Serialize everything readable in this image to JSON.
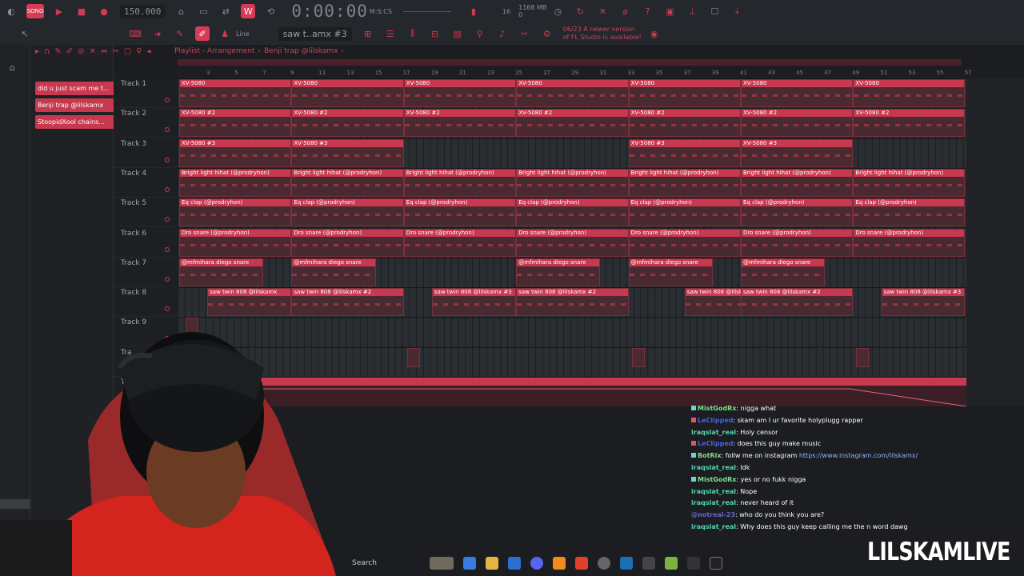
{
  "toolbar": {
    "song_mode": "SONG",
    "tempo": "150.000",
    "time": "0:00:00",
    "time_unit": "M:S:CS",
    "memory": "1168 MB",
    "memory_value": "0",
    "snap": "Line",
    "pattern": "saw t..amx #3",
    "notice_date": "06/23",
    "notice_text": "A newer version of FL Studio is available!",
    "cpu": "16"
  },
  "playlist": {
    "title": "Playlist - Arrangement",
    "pattern": "Benji trap @lilskamx",
    "ruler": [
      "3",
      "5",
      "7",
      "9",
      "11",
      "13",
      "15",
      "17",
      "19",
      "21",
      "23",
      "25",
      "27",
      "29",
      "31",
      "33",
      "35",
      "37",
      "39",
      "41",
      "43",
      "45",
      "47",
      "49",
      "51",
      "53",
      "55",
      "57"
    ]
  },
  "patterns": [
    {
      "label": "did u just scam me t..."
    },
    {
      "label": "Benji trap @lilskamx"
    },
    {
      "label": "StoopidXool chains..."
    }
  ],
  "tracks": [
    {
      "name": "Track 1"
    },
    {
      "name": "Track 2"
    },
    {
      "name": "Track 3"
    },
    {
      "name": "Track 4"
    },
    {
      "name": "Track 5"
    },
    {
      "name": "Track 6"
    },
    {
      "name": "Track 7"
    },
    {
      "name": "Track 8"
    },
    {
      "name": "Track 9"
    },
    {
      "name": "Tra"
    },
    {
      "name": "Tr"
    }
  ],
  "clip_names": {
    "xv1": "XV-5080",
    "xv2": "XV-5080 #2",
    "xv3": "XV-5080 #3",
    "hihat": "Bright light hihat (@prodryhon)",
    "clap": "Eq clap (@prodryhon)",
    "snare": "Dro snare (@prodryhon)",
    "diego": "@mfmihara diego snare",
    "saw1": "saw twin 808 @lilskamx",
    "saw2": "saw twin 808 @lilskamx #2",
    "saw3": "saw twin 808 @lilskamx #3"
  },
  "chat": [
    {
      "user": "MistGodRx",
      "color": "green",
      "msg": ": nigga what"
    },
    {
      "user": "LeClipped",
      "color": "blue",
      "msg": ": skam am I ur favorite holyplugg rapper"
    },
    {
      "user": "iraqslat_real",
      "color": "teal",
      "msg": ": Holy censor"
    },
    {
      "user": "LeClipped",
      "color": "blue",
      "msg": ": does this guy make music"
    },
    {
      "user": "BotRix",
      "color": "green",
      "msg": ": follw me on instagram ",
      "link": "https://www.instagram.com/lilskamx/"
    },
    {
      "user": "iraqslat_real",
      "color": "teal",
      "msg": ": Idk"
    },
    {
      "user": "MistGodRx",
      "color": "green",
      "msg": ": yes or no fukk nigga"
    },
    {
      "user": "iraqslat_real",
      "color": "teal",
      "msg": ": Nope"
    },
    {
      "user": "iraqslat_real",
      "color": "teal",
      "msg": ": never heard of it"
    },
    {
      "user": "@notreal-23",
      "color": "dim",
      "msg": ": who do you think you are?"
    },
    {
      "user": "iraqslat_real",
      "color": "teal",
      "msg": ": Why does this guy keep calling me the n word dawg"
    }
  ],
  "taskbar": {
    "search": "Search"
  },
  "watermark": "LILSKAMLIVE",
  "colors": {
    "accent": "#c8384e",
    "background": "#1b1d20"
  }
}
